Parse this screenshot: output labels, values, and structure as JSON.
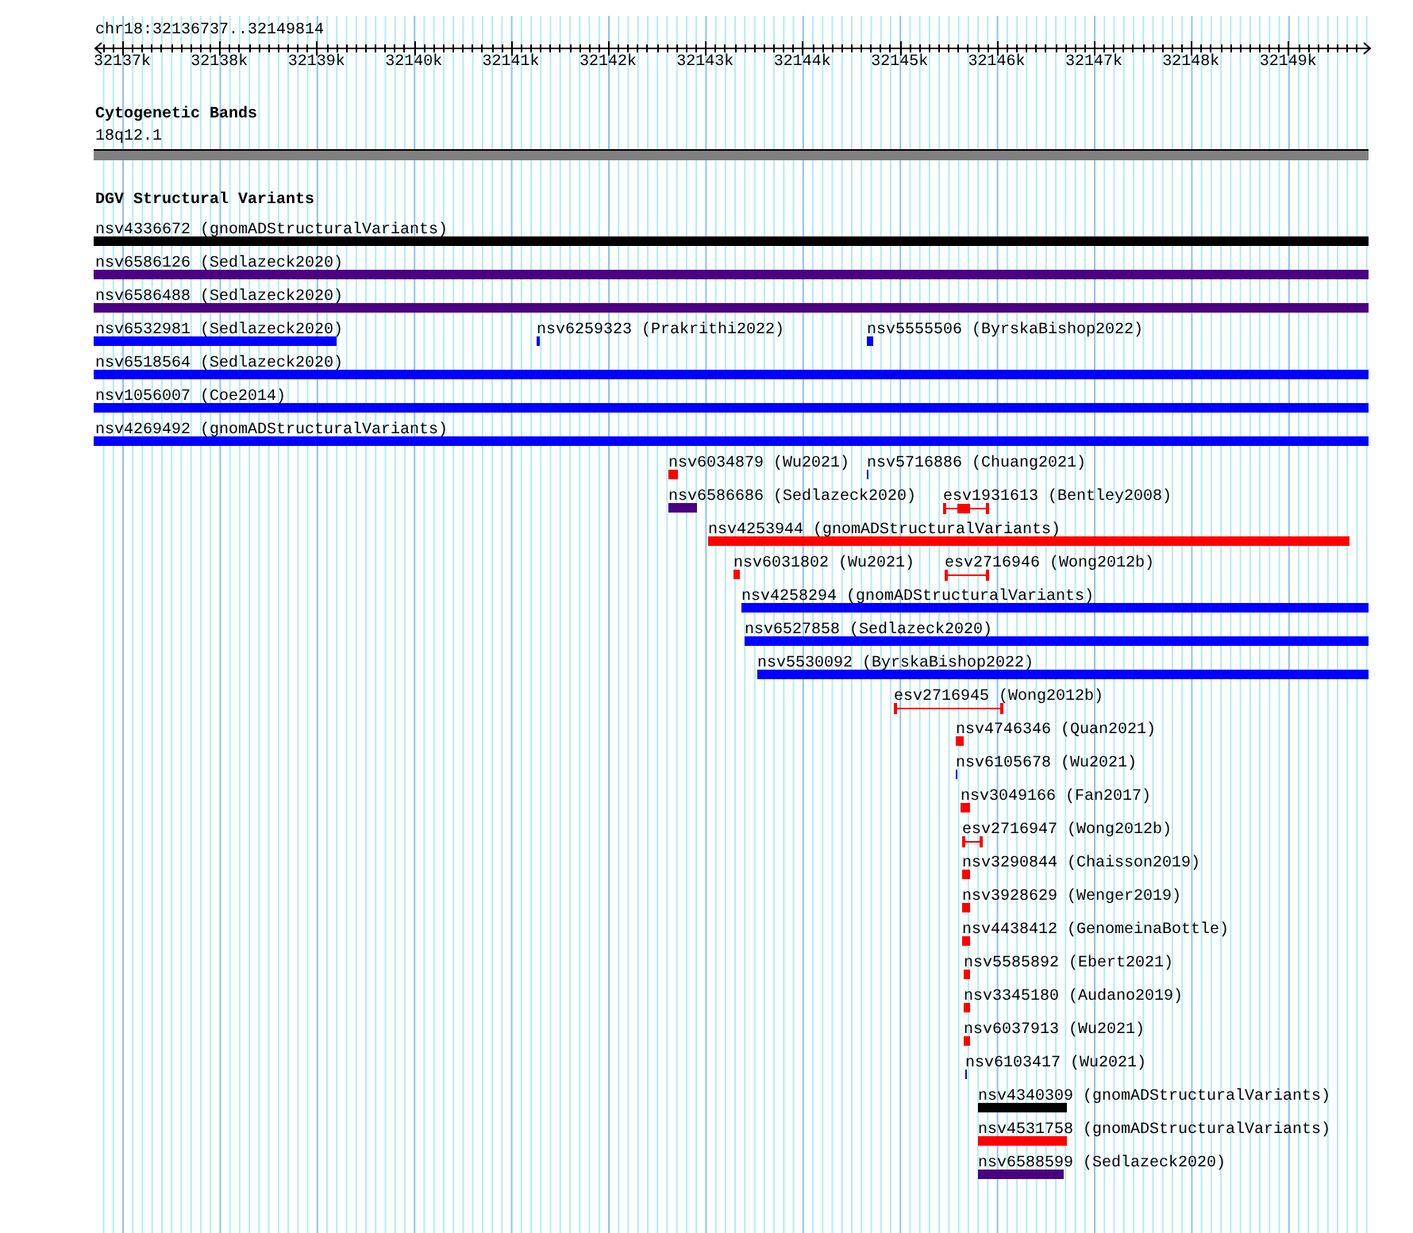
{
  "ruler": {
    "location": "chr18:32136737..32149814",
    "ticks": [
      "32137k",
      "32138k",
      "32139k",
      "32140k",
      "32141k",
      "32142k",
      "32143k",
      "32144k",
      "32145k",
      "32146k",
      "32147k",
      "32148k",
      "32149k"
    ]
  },
  "tracks": [
    {
      "title": "Cytogenetic Bands",
      "kind": "bands",
      "features": [
        {
          "label": "18q12.1",
          "kind": "band",
          "color": "#808080"
        }
      ]
    },
    {
      "title": "DGV Structural Variants",
      "kind": "variants",
      "features": [
        {
          "label": "nsv4336672 (gnomADStructuralVariants)",
          "kind": "bar",
          "color": "#000000"
        },
        {
          "label": "nsv6586126 (Sedlazeck2020)",
          "kind": "bar",
          "color": "#4b0082"
        },
        {
          "label": "nsv6586488 (Sedlazeck2020)",
          "kind": "bar",
          "color": "#4b0082"
        },
        {
          "label": "nsv6532981 (Sedlazeck2020)",
          "kind": "bar",
          "color": "#0000ff"
        },
        {
          "label": "nsv6259323 (Prakrithi2022)",
          "kind": "bar",
          "color": "#0000ff"
        },
        {
          "label": "nsv5555506 (ByrskaBishop2022)",
          "kind": "bar",
          "color": "#0000ff"
        },
        {
          "label": "nsv6518564 (Sedlazeck2020)",
          "kind": "bar",
          "color": "#0000ff"
        },
        {
          "label": "nsv1056007 (Coe2014)",
          "kind": "bar",
          "color": "#0000ff"
        },
        {
          "label": "nsv4269492 (gnomADStructuralVariants)",
          "kind": "bar",
          "color": "#0000ff"
        },
        {
          "label": "nsv6034879 (Wu2021)",
          "kind": "bar",
          "color": "#ff0000"
        },
        {
          "label": "nsv5716886 (Chuang2021)",
          "kind": "bar",
          "color": "#0000ff"
        },
        {
          "label": "nsv6586686 (Sedlazeck2020)",
          "kind": "bar",
          "color": "#4b0082"
        },
        {
          "label": "esv1931613 (Bentley2008)",
          "kind": "cored",
          "color": "#ff0000"
        },
        {
          "label": "nsv4253944 (gnomADStructuralVariants)",
          "kind": "bar",
          "color": "#ff0000"
        },
        {
          "label": "nsv6031802 (Wu2021)",
          "kind": "bar",
          "color": "#ff0000"
        },
        {
          "label": "esv2716946 (Wong2012b)",
          "kind": "span",
          "color": "#ff0000"
        },
        {
          "label": "nsv4258294 (gnomADStructuralVariants)",
          "kind": "bar",
          "color": "#0000ff"
        },
        {
          "label": "nsv6527858 (Sedlazeck2020)",
          "kind": "bar",
          "color": "#0000ff"
        },
        {
          "label": "nsv5530092 (ByrskaBishop2022)",
          "kind": "bar",
          "color": "#0000ff"
        },
        {
          "label": "esv2716945 (Wong2012b)",
          "kind": "span",
          "color": "#ff0000"
        },
        {
          "label": "nsv4746346 (Quan2021)",
          "kind": "bar",
          "color": "#ff0000"
        },
        {
          "label": "nsv6105678 (Wu2021)",
          "kind": "bar",
          "color": "#0000ff"
        },
        {
          "label": "nsv3049166 (Fan2017)",
          "kind": "bar",
          "color": "#ff0000"
        },
        {
          "label": "esv2716947 (Wong2012b)",
          "kind": "span",
          "color": "#ff0000"
        },
        {
          "label": "nsv3290844 (Chaisson2019)",
          "kind": "bar",
          "color": "#ff0000"
        },
        {
          "label": "nsv3928629 (Wenger2019)",
          "kind": "bar",
          "color": "#ff0000"
        },
        {
          "label": "nsv4438412 (GenomeinaBottle)",
          "kind": "bar",
          "color": "#ff0000"
        },
        {
          "label": "nsv5585892 (Ebert2021)",
          "kind": "bar",
          "color": "#ff0000"
        },
        {
          "label": "nsv3345180 (Audano2019)",
          "kind": "bar",
          "color": "#ff0000"
        },
        {
          "label": "nsv6037913 (Wu2021)",
          "kind": "bar",
          "color": "#ff0000"
        },
        {
          "label": "nsv6103417 (Wu2021)",
          "kind": "bar",
          "color": "#0000ff"
        },
        {
          "label": "nsv4340309 (gnomADStructuralVariants)",
          "kind": "bar",
          "color": "#000000"
        },
        {
          "label": "nsv4531758 (gnomADStructuralVariants)",
          "kind": "bar",
          "color": "#ff0000"
        },
        {
          "label": "nsv6588599 (Sedlazeck2020)",
          "kind": "bar",
          "color": "#4b0082"
        }
      ]
    }
  ]
}
